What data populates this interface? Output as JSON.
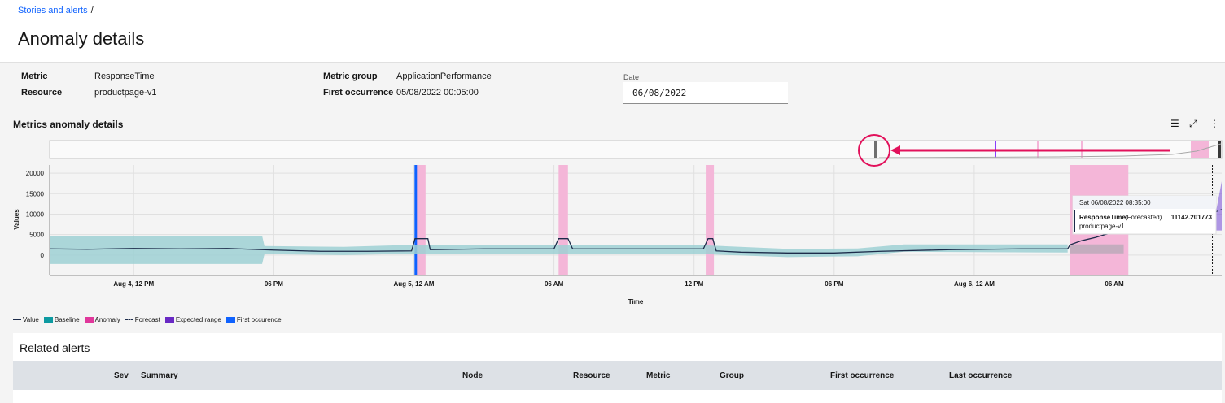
{
  "breadcrumb": {
    "link": "Stories and alerts",
    "separator": "/"
  },
  "page_title": "Anomaly details",
  "meta": {
    "metric_label": "Metric",
    "metric_value": "ResponseTime",
    "resource_label": "Resource",
    "resource_value": "productpage-v1",
    "group_label": "Metric group",
    "group_value": "ApplicationPerformance",
    "first_label": "First occurrence",
    "first_value": "05/08/2022 00:05:00",
    "date_label": "Date",
    "date_value": "06/08/2022"
  },
  "section_title": "Metrics anomaly details",
  "toolbar_icons": [
    "list-icon",
    "expand-icon",
    "overflow-menu-icon"
  ],
  "chart_data": {
    "type": "line",
    "xlabel": "Time",
    "ylabel": "Values",
    "y_ticks": [
      20000,
      15000,
      10000,
      5000,
      0
    ],
    "ylim": [
      -5000,
      22000
    ],
    "x_ticks": [
      "Aug 4, 12 PM",
      "06 PM",
      "Aug 5, 12 AM",
      "06 AM",
      "12 PM",
      "06 PM",
      "Aug 6, 12 AM",
      "06 AM"
    ],
    "x_range_hours": [
      -15.6,
      34.6
    ],
    "anomaly_windows_hours": [
      [
        0.1,
        0.5
      ],
      [
        6.2,
        6.6
      ],
      [
        12.5,
        12.85
      ],
      [
        28.1,
        30.6
      ]
    ],
    "first_occurrence_hours": 0.08,
    "value_series": [
      [
        -15.6,
        1500
      ],
      [
        -14,
        1400
      ],
      [
        -12,
        1600
      ],
      [
        -10,
        1500
      ],
      [
        -8,
        1600
      ],
      [
        -6,
        1200
      ],
      [
        -4,
        900
      ],
      [
        -2,
        900
      ],
      [
        -0.1,
        1000
      ],
      [
        0.05,
        4000
      ],
      [
        0.6,
        4000
      ],
      [
        0.7,
        1300
      ],
      [
        3,
        1500
      ],
      [
        6.0,
        1500
      ],
      [
        6.2,
        4000
      ],
      [
        6.6,
        4000
      ],
      [
        6.8,
        1500
      ],
      [
        10,
        1500
      ],
      [
        12.4,
        1500
      ],
      [
        12.6,
        4000
      ],
      [
        12.8,
        4000
      ],
      [
        12.95,
        1000
      ],
      [
        14,
        700
      ],
      [
        16,
        500
      ],
      [
        18,
        500
      ],
      [
        20,
        900
      ],
      [
        23,
        1300
      ],
      [
        26,
        1500
      ],
      [
        28.0,
        1500
      ],
      [
        28.1,
        2500
      ],
      [
        28.6,
        3500
      ],
      [
        29.2,
        4300
      ],
      [
        29.6,
        5000
      ],
      [
        30.0,
        5500
      ]
    ],
    "baseline_band": [
      [
        -15.6,
        -2200,
        4700
      ],
      [
        -8,
        -2200,
        4700
      ],
      [
        -6.5,
        -2200,
        4700
      ],
      [
        -6.4,
        200,
        2200
      ],
      [
        -3,
        0,
        2000
      ],
      [
        0,
        300,
        2500
      ],
      [
        6,
        300,
        2500
      ],
      [
        12,
        300,
        2500
      ],
      [
        16,
        -500,
        1500
      ],
      [
        19,
        -300,
        1600
      ],
      [
        21,
        800,
        2600
      ],
      [
        28,
        600,
        2600
      ]
    ],
    "forecast": {
      "point_hours": 34.4,
      "value": 11142.201773
    },
    "legend": [
      "Value",
      "Baseline",
      "Anomaly",
      "Forecast",
      "Expected range",
      "First occurence"
    ],
    "colors": {
      "value": "#1c2b4a",
      "baseline": "#9dd0d4",
      "anomaly": "#f4b6d8",
      "first": "#0f62fe",
      "expected": "#7f56d9",
      "grid": "#e0e0e0"
    }
  },
  "tooltip": {
    "date": "Sat 06/08/2022 08:35:00",
    "metric": "ResponseTime",
    "kind": "(Forecasted)",
    "value": "11142.201773",
    "resource": "productpage-v1"
  },
  "legend_labels": {
    "value": "Value",
    "baseline": "Baseline",
    "anomaly": "Anomaly",
    "forecast": "Forecast",
    "expected": "Expected range",
    "first": "First occurence"
  },
  "related_alerts": {
    "title": "Related alerts",
    "columns": [
      "Sev",
      "Summary",
      "Node",
      "Resource",
      "Metric",
      "Group",
      "First occurrence",
      "Last occurrence"
    ]
  }
}
